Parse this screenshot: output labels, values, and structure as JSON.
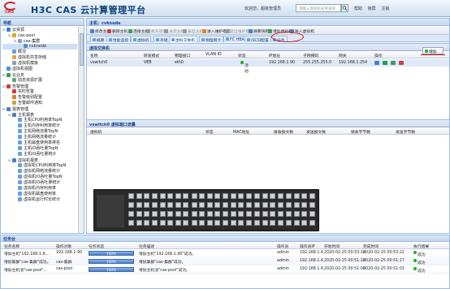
{
  "app": {
    "logo_text": "CAS",
    "title": "H3C CAS 云计算管理平台",
    "welcome": "欢迎您，超级管理员",
    "search_placeholder": "请输入虚拟机名称查询",
    "header_links": [
      "帮助",
      "锁屏",
      "注销"
    ]
  },
  "nav": {
    "header": "导航",
    "items": [
      {
        "label": "云资源",
        "level": 0,
        "color": "#3b7dd8",
        "toggle": "⊟"
      },
      {
        "label": "cas-pool",
        "level": 1,
        "color": "#e4a52a",
        "toggle": "⊟"
      },
      {
        "label": "cas-集群",
        "level": 2,
        "color": "#7aa3d6",
        "toggle": "⊟"
      },
      {
        "label": "cvknode",
        "level": 3,
        "color": "#5a8bc7",
        "toggle": ""
      },
      {
        "label": "概况",
        "level": 1,
        "color": "#6aa0d8",
        "toggle": ""
      },
      {
        "label": "虚拟机共享存储",
        "level": 1,
        "color": "#e6a23c",
        "toggle": ""
      },
      {
        "label": "虚拟机模板",
        "level": 1,
        "color": "#8c9eb8",
        "toggle": ""
      },
      {
        "label": "虚拟机视图",
        "level": 0,
        "color": "#4a8fd6",
        "toggle": ""
      },
      {
        "label": "云业务",
        "level": 0,
        "color": "#3b9d5a",
        "toggle": "⊟"
      },
      {
        "label": "动态资源扩展",
        "level": 1,
        "color": "#5cae6e",
        "toggle": ""
      },
      {
        "label": "告警管理",
        "level": 0,
        "color": "#d23c3c",
        "toggle": "⊟"
      },
      {
        "label": "实时告警",
        "level": 1,
        "color": "#d23c3c",
        "toggle": ""
      },
      {
        "label": "告警级别配置",
        "level": 1,
        "color": "#e08030",
        "toggle": ""
      },
      {
        "label": "告警邮件通知",
        "level": 1,
        "color": "#d2a03c",
        "toggle": ""
      },
      {
        "label": "报表管理",
        "level": 0,
        "color": "#4a7fc8",
        "toggle": "⊟"
      },
      {
        "label": "主机报表",
        "level": 1,
        "color": "#4a7fc8",
        "toggle": "⊟"
      },
      {
        "label": "主机CPU利用率TopN",
        "level": 2,
        "color": "#6a9fd8",
        "toggle": ""
      },
      {
        "label": "主机内存利用率统计",
        "level": 2,
        "color": "#6a9fd8",
        "toggle": ""
      },
      {
        "label": "主机网络流量TopN",
        "level": 2,
        "color": "#6a9fd8",
        "toggle": ""
      },
      {
        "label": "主机网络流量统计",
        "level": 2,
        "color": "#6a9fd8",
        "toggle": ""
      },
      {
        "label": "主机磁盘使用率排名",
        "level": 2,
        "color": "#6a9fd8",
        "toggle": ""
      },
      {
        "label": "主机IO吞吐量TopN",
        "level": 2,
        "color": "#6a9fd8",
        "toggle": ""
      },
      {
        "label": "主机IO吞吐量统计",
        "level": 2,
        "color": "#6a9fd8",
        "toggle": ""
      },
      {
        "label": "虚拟机报表",
        "level": 1,
        "color": "#4a7fc8",
        "toggle": "⊟"
      },
      {
        "label": "虚拟机CPU利用率TopN",
        "level": 2,
        "color": "#6a9fd8",
        "toggle": ""
      },
      {
        "label": "虚拟机网络流量统计",
        "level": 2,
        "color": "#6a9fd8",
        "toggle": ""
      },
      {
        "label": "虚拟机IO吞吐量TopN",
        "level": 2,
        "color": "#6a9fd8",
        "toggle": ""
      },
      {
        "label": "虚拟机IO吞吐量统计",
        "level": 2,
        "color": "#6a9fd8",
        "toggle": ""
      },
      {
        "label": "虚拟机内存利用率",
        "level": 2,
        "color": "#6a9fd8",
        "toggle": ""
      },
      {
        "label": "虚拟机磁盘使用率",
        "level": 2,
        "color": "#6a9fd8",
        "toggle": ""
      },
      {
        "label": "虚拟机运行时长统计",
        "level": 2,
        "color": "#6a9fd8",
        "toggle": ""
      }
    ]
  },
  "main": {
    "header": "主机：cvknode",
    "toolbar": [
      {
        "label": "修改主机",
        "color": "#4a7fc8"
      },
      {
        "label": "删除主机",
        "color": "#d23c3c"
      },
      {
        "label": "连接主机",
        "color": "#3b9d5a"
      },
      {
        "label": "断开连接",
        "color": "#999999"
      },
      {
        "label": "关闭主机",
        "color": "#999999"
      },
      {
        "label": "重启主机",
        "color": "#999999"
      },
      {
        "label": "进入维护模式",
        "color": "#e08030"
      },
      {
        "label": "退出维护模式",
        "color": "#999999"
      },
      {
        "label": "摘要快照",
        "color": "#4a7fc8"
      },
      {
        "label": "增加虚拟机",
        "color": "#3b9d5a"
      },
      {
        "label": "导入虚拟机",
        "color": "#4a7fc8"
      }
    ],
    "tabs": [
      "概要",
      "性能监控",
      "虚拟机",
      "存储",
      "虚拟交换机",
      "物理网卡",
      "FC HBA",
      "iSCSI配置",
      "任务"
    ],
    "active_tab": 4,
    "vswitch_panel": {
      "title": "虚拟交换机",
      "add_label": "增加",
      "columns": [
        "名称",
        "转发模式",
        "物理接口",
        "VLAN ID",
        "状态",
        "IP地址",
        "子网掩码",
        "网关",
        "操作"
      ],
      "rows": [
        {
          "name": "vswitch0",
          "mode": "VEB",
          "nic": "eth0",
          "vlan": "",
          "status": "活动",
          "ip": "192.168.1.90",
          "mask": "255.255.255.0",
          "gw": "192.168.1.254"
        }
      ]
    },
    "port_panel": {
      "title": "vswitch0 虚拟端口流量",
      "columns": [
        "虚拟机",
        "状态",
        "MAC地址",
        "接收报文数",
        "发送报文数",
        "接收字节数",
        "发送字节数"
      ]
    }
  },
  "tasks": {
    "title": "任务台",
    "columns": [
      "任务名称",
      "操作对象",
      "任务状态",
      "任务描述",
      "操作员",
      "操作员IP",
      "开始时间",
      "完成时间",
      "执行结果"
    ],
    "rows": [
      {
        "name": "增加主机\"192.168.1.9...",
        "target": "192.168.1.90",
        "progress": "100%",
        "desc": "增加主机\"192.168.1.90\"成功。",
        "op": "admin",
        "ip": "192.168.1.6",
        "start": "2020-02-25 00:53:16",
        "end": "2020-02-25 00:53:22",
        "result": "成功"
      },
      {
        "name": "增加集群\"cas-集群\"成功。",
        "target": "cas-集群",
        "progress": "100%",
        "desc": "增加集群\"cas-集群\"成功。",
        "op": "admin",
        "ip": "192.168.1.6",
        "start": "2020-02-25 00:51:16",
        "end": "2020-02-25 00:51:17",
        "result": "成功"
      },
      {
        "name": "增加主机池\"cas-pool\"...",
        "target": "cas-pool",
        "progress": "100%",
        "desc": "增加主机池\"cas-pool\"成功。",
        "op": "admin",
        "ip": "192.168.1.6",
        "start": "2020-02-25 00:51:00",
        "end": "2020-02-25 00:51:01",
        "result": "成功"
      }
    ]
  }
}
